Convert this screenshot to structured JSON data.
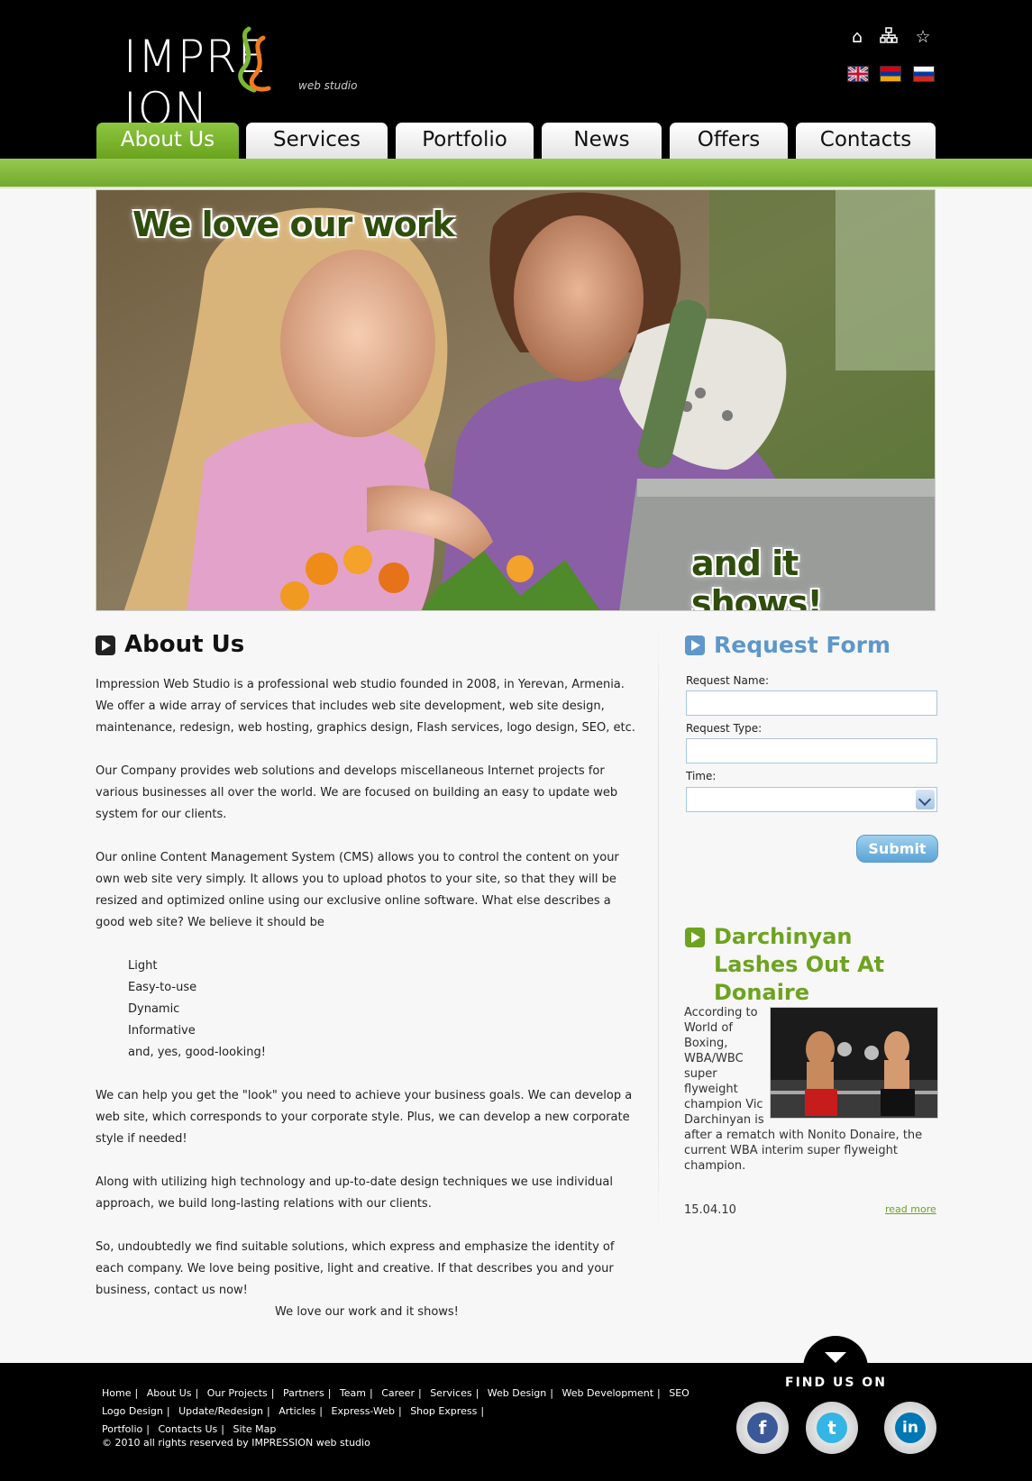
{
  "brand": {
    "logo_main_left": "IMPRE",
    "logo_main_right": "ION",
    "logo_sub": "web studio"
  },
  "top_icons": [
    "home-icon",
    "sitemap-icon",
    "star-icon"
  ],
  "languages": [
    "English",
    "Armenian",
    "Russian"
  ],
  "nav": {
    "tabs": [
      "About Us",
      "Services",
      "Portfolio",
      "News",
      "Offers",
      "Contacts"
    ],
    "active": "About Us"
  },
  "hero": {
    "line1": "We love our work",
    "line2": "and it shows!"
  },
  "about": {
    "title": "About Us",
    "p1": "Impression Web Studio is a professional web studio founded in 2008, in Yerevan, Armenia. We offer a wide array of services that includes web site development, web site design, maintenance, redesign, web hosting, graphics design, Flash services, logo design, SEO, etc.",
    "p2": "Our Company provides web solutions and develops miscellaneous Internet projects for various businesses all over the world. We are focused on building an easy to update web system for our clients.",
    "p3": "Our online Content Management System (CMS) allows you to control the content on your own web site very simply. It allows you to upload photos to your site, so that they will be resized and optimized online using our exclusive online software. What else describes a good web site? We believe it should be",
    "list": [
      "Light",
      "Easy-to-use",
      "Dynamic",
      "Informative",
      "and, yes, good-looking!"
    ],
    "p4": "We can help you get the \"look\" you need to achieve your business goals. We can develop a web site, which corresponds to your corporate style. Plus, we can develop a new corporate style if needed!",
    "p5": "Along with utilizing high technology and up-to-date design techniques we use individual approach, we build long-lasting relations with our clients.",
    "p6": "So, undoubtedly we find suitable solutions, which express and emphasize the identity of each company. We love being positive, light and creative. If that describes you and your business, contact us now!",
    "closing": "We love our work and it shows!"
  },
  "request_form": {
    "title": "Request Form",
    "name_label": "Request Name:",
    "type_label": "Request Type:",
    "time_label": "Time:",
    "name_value": "",
    "type_value": "",
    "time_value": "",
    "submit_label": "Submit"
  },
  "news": {
    "title": "Darchinyan Lashes Out At Donaire",
    "text": "According to World of Boxing, WBA/WBC super flyweight champion Vic Darchinyan is after a rematch with Nonito Donaire, the current WBA interim super flyweight champion.",
    "date": "15.04.10",
    "read_more": "read more"
  },
  "footer": {
    "links": [
      "Home",
      "About Us",
      "Our Projects",
      "Partners",
      "Team",
      "Career",
      "Services",
      "Web Design",
      "Web Development",
      "SEO",
      "Logo Design",
      "Update/Redesign",
      "Articles",
      "Express-Web",
      "Shop Express",
      "Portfolio",
      "Contacts Us",
      "Site Map"
    ],
    "copyright": "© 2010 all rights reserved by IMPRESSION web studio",
    "find_us": "FIND US ON",
    "social": [
      "facebook-icon",
      "twitter-icon",
      "linkedin-icon"
    ]
  },
  "colors": {
    "accent_green": "#7cb732",
    "accent_blue": "#5e97c9",
    "header_bg": "#000000"
  }
}
